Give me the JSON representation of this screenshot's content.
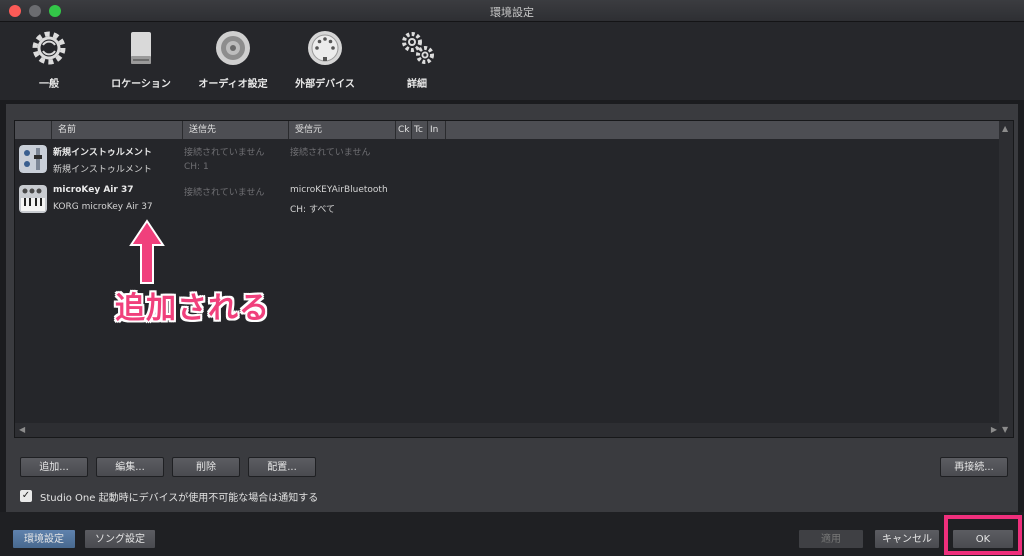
{
  "window": {
    "title": "環境設定"
  },
  "toolbar": {
    "items": [
      {
        "label": "一般",
        "icon": "gear-icon"
      },
      {
        "label": "ロケーション",
        "icon": "drive-icon"
      },
      {
        "label": "オーディオ設定",
        "icon": "speaker-icon"
      },
      {
        "label": "外部デバイス",
        "icon": "midi-port-icon"
      },
      {
        "label": "詳細",
        "icon": "gears-icon"
      }
    ]
  },
  "table": {
    "columns": [
      "名前",
      "送信先",
      "受信元",
      "Ck",
      "Tc",
      "In"
    ],
    "rows": [
      {
        "icon": "instrument-icon",
        "name": "新規インストゥルメント",
        "subname": "新規インストゥルメント",
        "send": "接続されていません",
        "receive": "接続されていません",
        "receive_sub": "CH: 1"
      },
      {
        "icon": "keyboard-icon",
        "name": "microKey Air 37",
        "subname": "KORG microKey Air 37",
        "send": "接続されていません",
        "receive": "microKEYAirBluetooth",
        "receive_sub": "CH: すべて"
      }
    ]
  },
  "annotation": {
    "text": "追加される",
    "color": "#f0407c"
  },
  "actions": {
    "add": "追加...",
    "edit": "編集...",
    "delete": "削除",
    "arrange": "配置...",
    "reconnect": "再接続..."
  },
  "option": {
    "checked": true,
    "label": "Studio One 起動時にデバイスが使用不可能な場合は通知する"
  },
  "footer": {
    "tab_prefs": "環境設定",
    "tab_song": "ソング設定",
    "apply": "適用",
    "cancel": "キャンセル",
    "ok": "OK",
    "highlight_color": "#ef2f7c"
  }
}
